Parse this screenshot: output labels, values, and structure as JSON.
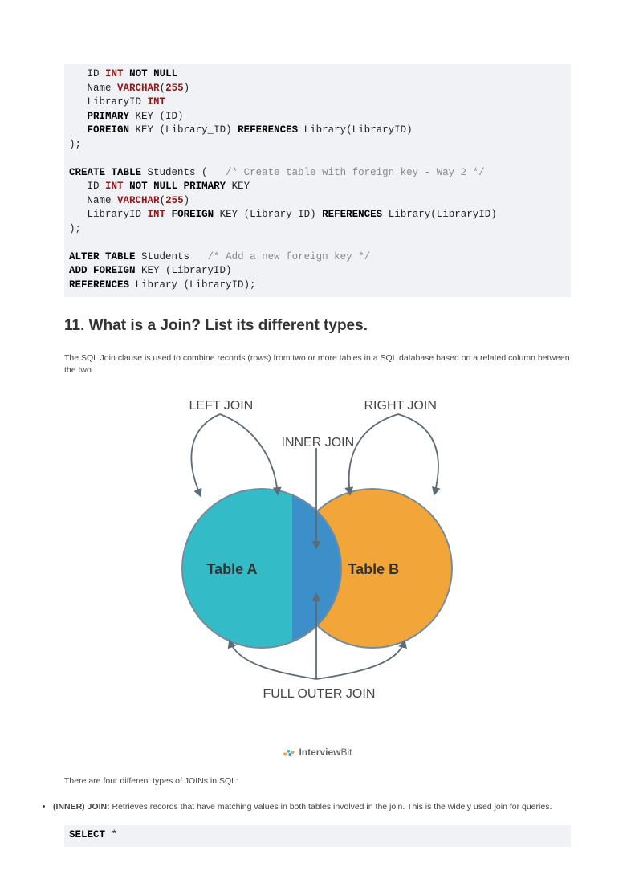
{
  "code1": {
    "l1_id": "ID",
    "l1_int": "INT",
    "l1_notnull": "NOT NULL",
    "l2_name": "Name",
    "l2_varchar": "VARCHAR",
    "l2_num": "255",
    "l3_lib": "LibraryID",
    "l3_int": "INT",
    "l4_pk": "PRIMARY",
    "l4_key": "KEY (ID)",
    "l5_fk": "FOREIGN",
    "l5_rest": "KEY (Library_ID)",
    "l5_ref": "REFERENCES",
    "l5_tail": "Library(LibraryID)",
    "l6": ");",
    "l8_ct": "CREATE TABLE",
    "l8_tbl": "Students (",
    "l8_cmt": "/* Create table with foreign key - Way 2 */",
    "l9_id": "ID",
    "l9_int": "INT",
    "l9_notnull": "NOT NULL PRIMARY",
    "l9_key": "KEY",
    "l10_name": "Name",
    "l10_varchar": "VARCHAR",
    "l10_num": "255",
    "l11_lib": "LibraryID",
    "l11_int": "INT",
    "l11_fk": "FOREIGN",
    "l11_rest": "KEY (Library_ID)",
    "l11_ref": "REFERENCES",
    "l11_tail": "Library(LibraryID)",
    "l12": ");",
    "l14_at": "ALTER TABLE",
    "l14_tbl": "Students",
    "l14_cmt": "/* Add a new foreign key */",
    "l15_af": "ADD FOREIGN",
    "l15_rest": "KEY (LibraryID)",
    "l16_ref": "REFERENCES",
    "l16_rest": "Library (LibraryID);"
  },
  "question": {
    "title": "11. What is a Join? List its different types.",
    "intro": "The SQL Join clause is used to combine records (rows) from two or more tables in a SQL database based on a related column between the two."
  },
  "diagram": {
    "left_join": "LEFT JOIN",
    "right_join": "RIGHT JOIN",
    "inner_join": "INNER JOIN",
    "full_outer": "FULL OUTER JOIN",
    "table_a": "Table A",
    "table_b": "Table B",
    "brand_main": "Interview",
    "brand_suffix": "Bit"
  },
  "after_diagram": "There are four different types of JOINs in SQL:",
  "bullet1": {
    "term": "(INNER) JOIN:",
    "rest": " Retrieves records that have matching values in both tables involved in the join. This is the widely used join for queries."
  },
  "code2": {
    "select": "SELECT",
    "star": " *"
  }
}
